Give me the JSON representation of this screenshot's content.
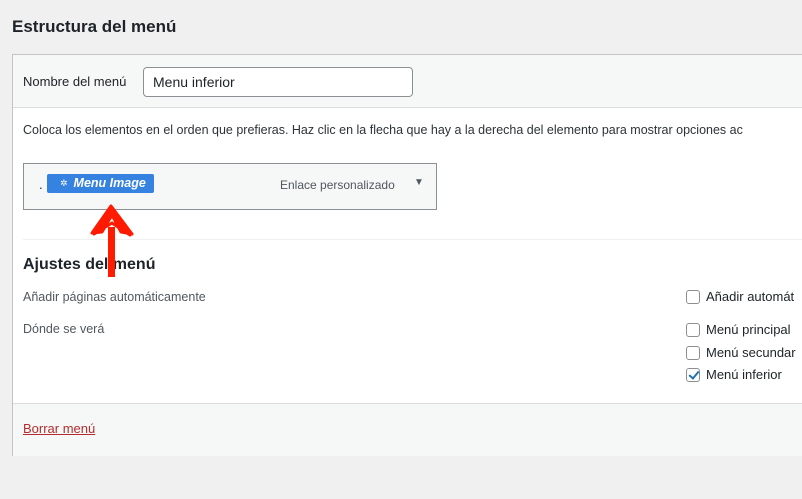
{
  "section_title": "Estructura del menú",
  "menu_name": {
    "label": "Nombre del menú",
    "value": "Menu inferior"
  },
  "instructions": "Coloca los elementos en el orden que prefieras. Haz clic en la flecha que hay a la derecha del elemento para mostrar opciones ac",
  "menu_items": [
    {
      "prefix": ".",
      "icon": "gear-icon",
      "title": "Menu Image",
      "type": "Enlace personalizado",
      "toggle": "▼"
    }
  ],
  "settings": {
    "title": "Ajustes del menú",
    "auto_add": {
      "label": "Añadir páginas automáticamente",
      "option": "Añadir automát",
      "checked": false
    },
    "locations": {
      "label": "Dónde se verá",
      "options": [
        {
          "label": "Menú principal",
          "checked": false
        },
        {
          "label": "Menú secundar",
          "checked": false
        },
        {
          "label": "Menú inferior",
          "checked": true
        }
      ]
    }
  },
  "footer": {
    "delete_label": "Borrar menú"
  },
  "colors": {
    "badge": "#3582e0",
    "annotation": "#ff1a00",
    "delete_link": "#b32d2e",
    "checkmark": "#2271b1"
  }
}
